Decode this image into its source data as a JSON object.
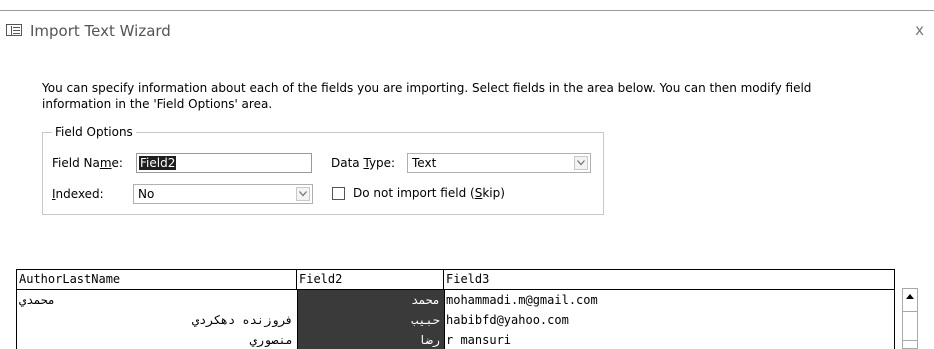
{
  "window": {
    "title": "Import Text Wizard",
    "close_glyph": "x"
  },
  "description": "You can specify information about each of the fields you are importing.  Select fields in the area below. You can then modify field information in the 'Field Options' area.",
  "field_options": {
    "legend": "Field Options",
    "field_name_label": {
      "before": "Field Na",
      "key": "m",
      "after": "e:"
    },
    "field_name_value": "Field2",
    "data_type_label": {
      "before": "Data ",
      "key": "T",
      "after": "ype:"
    },
    "data_type_value": "Text",
    "indexed_label": {
      "before": "",
      "key": "I",
      "after": "ndexed:"
    },
    "indexed_value": "No",
    "skip_label": {
      "before": "Do not import field (",
      "key": "S",
      "after": "kip)"
    },
    "skip_checked": false
  },
  "preview": {
    "columns": [
      "AuthorLastName",
      "Field2",
      "Field3"
    ],
    "selected_column": "Field2",
    "rows": [
      [
        "محمدي",
        "محمد",
        "mohammadi.m@gmail.com"
      ],
      [
        "فروزنده دهكردي",
        "حبيب",
        "habibfd@yahoo.com"
      ],
      [
        "منصوري",
        "رضا",
        "r mansuri"
      ]
    ]
  },
  "icons": {
    "title": "table-import-icon",
    "combo_arrow": "chevron-down-icon",
    "scroll_up": "triangle-up-icon"
  }
}
